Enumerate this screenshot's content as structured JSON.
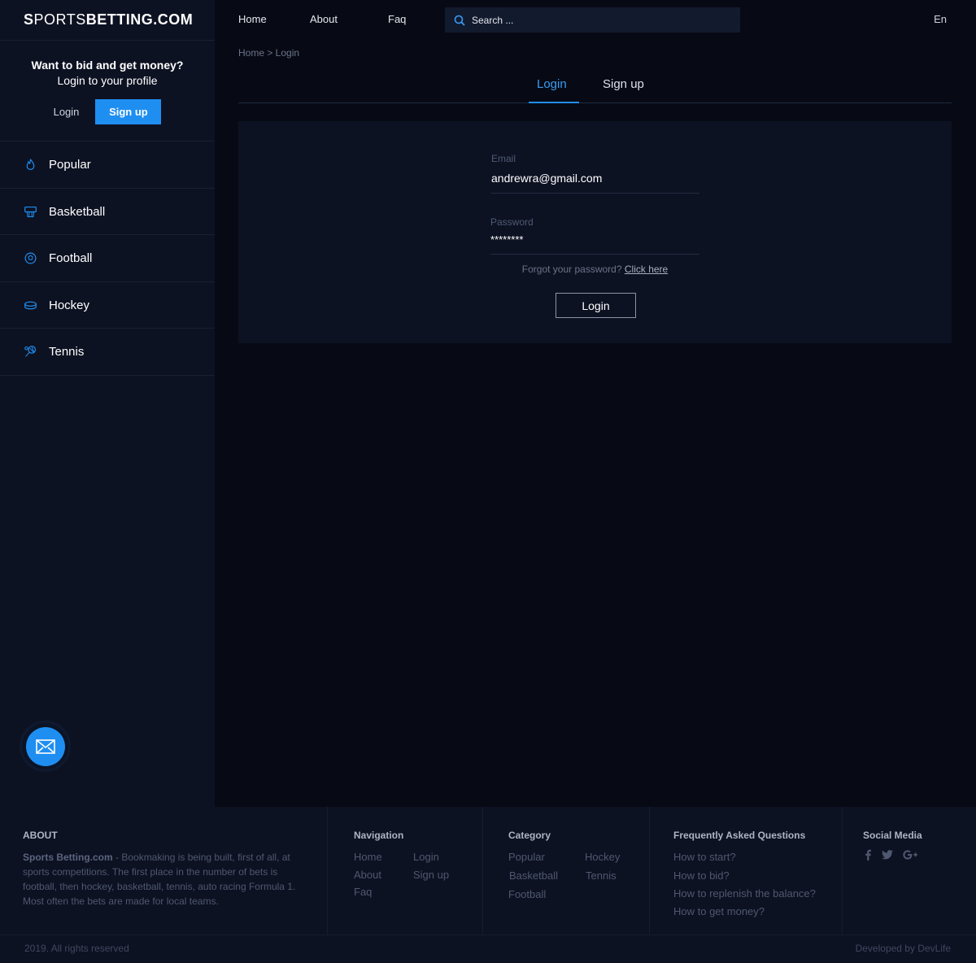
{
  "brand": {
    "part1": "S",
    "part2": "PORTS ",
    "part3": "BETTING.COM"
  },
  "promo": {
    "title": "Want to bid and get money?",
    "subtitle": "Login to your profile",
    "login_label": "Login",
    "signup_label": "Sign up"
  },
  "categories": [
    {
      "label": "Popular",
      "icon": "flame-icon"
    },
    {
      "label": "Basketball",
      "icon": "basketball-hoop-icon"
    },
    {
      "label": "Football",
      "icon": "soccer-ball-icon"
    },
    {
      "label": "Hockey",
      "icon": "hockey-puck-icon"
    },
    {
      "label": "Tennis",
      "icon": "tennis-racket-icon"
    }
  ],
  "nav": {
    "home": "Home",
    "about": "About",
    "faq": "Faq",
    "search_placeholder": "Search ...",
    "lang": "En"
  },
  "breadcrumb": "Home > Login",
  "tabs": {
    "login": "Login",
    "signup": "Sign up",
    "active": "login"
  },
  "form": {
    "email_label": "Email",
    "email_value": "andrewra@gmail.com",
    "password_label": "Password",
    "password_value": "********",
    "forgot_text": "Forgot your password?",
    "forgot_link": "Click here",
    "login_button": "Login"
  },
  "footer": {
    "about_heading": "ABOUT",
    "about_brand": "Sports Betting.com",
    "about_text": " - Bookmaking is being built, first of all, at sports competitions. The first place in the number of bets is football, then hockey, basketball, tennis, auto racing Formula 1. Most often the bets are made for local teams.",
    "navigation_heading": "Navigation",
    "navigation_links": [
      "Home",
      "Login",
      "About",
      "Sign up",
      "Faq"
    ],
    "category_heading": "Category",
    "category_links": [
      "Popular",
      "Hockey",
      "Basketball",
      "Tennis",
      "Football"
    ],
    "faq_heading": "Frequently Asked Questions",
    "faq_links": [
      "How to start?",
      "How to bid?",
      "How to replenish the balance?",
      "How to get money?"
    ],
    "social_heading": "Social Media",
    "social_icons": [
      "facebook-icon",
      "twitter-icon",
      "google-plus-icon"
    ],
    "copyright": "2019. All rights reserved",
    "developer": "Developed by DevLife"
  },
  "colors": {
    "accent": "#1f8ef1",
    "background": "#070a14",
    "panel": "#0d1222"
  }
}
